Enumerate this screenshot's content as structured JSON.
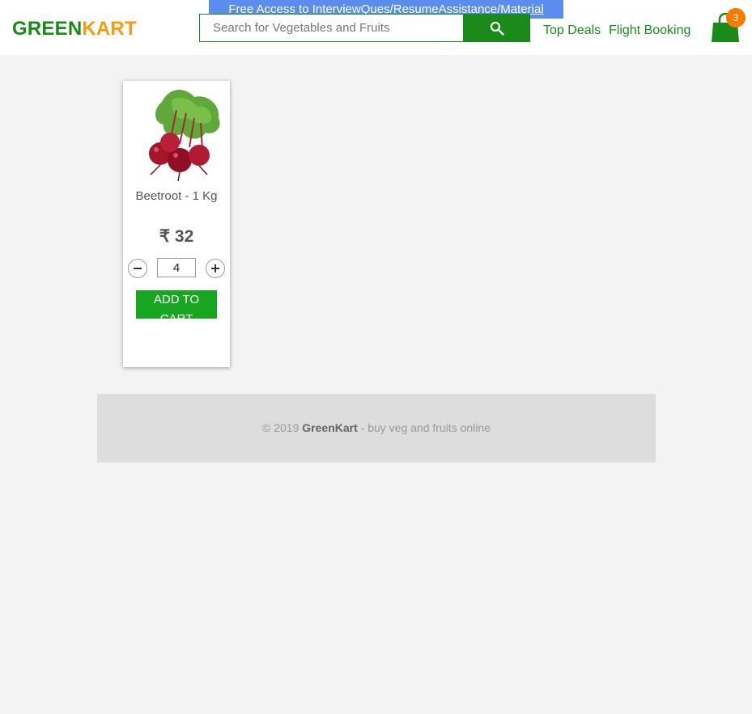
{
  "header": {
    "promo_text": "Free Access to InterviewQues/ResumeAssistance/Material",
    "logo_green": "GREEN",
    "logo_kart": "KART",
    "search_placeholder": "Search for Vegetables and Fruits",
    "nav": [
      "Top Deals",
      "Flight Booking"
    ],
    "cart_count": "3"
  },
  "products": [
    {
      "name": "Beetroot - 1 Kg",
      "price": "₹ 32",
      "quantity": "4",
      "add_label": "ADD TO CART"
    }
  ],
  "footer": {
    "prefix": "© 2019 ",
    "brand": "GreenKart",
    "suffix": " - buy veg and fruits online"
  },
  "colors": {
    "brand_green": "#1a8a1a",
    "brand_orange": "#f39c12",
    "button_green": "#18a51f",
    "promo_blue": "#5b8def",
    "badge_orange": "#f57c00"
  }
}
